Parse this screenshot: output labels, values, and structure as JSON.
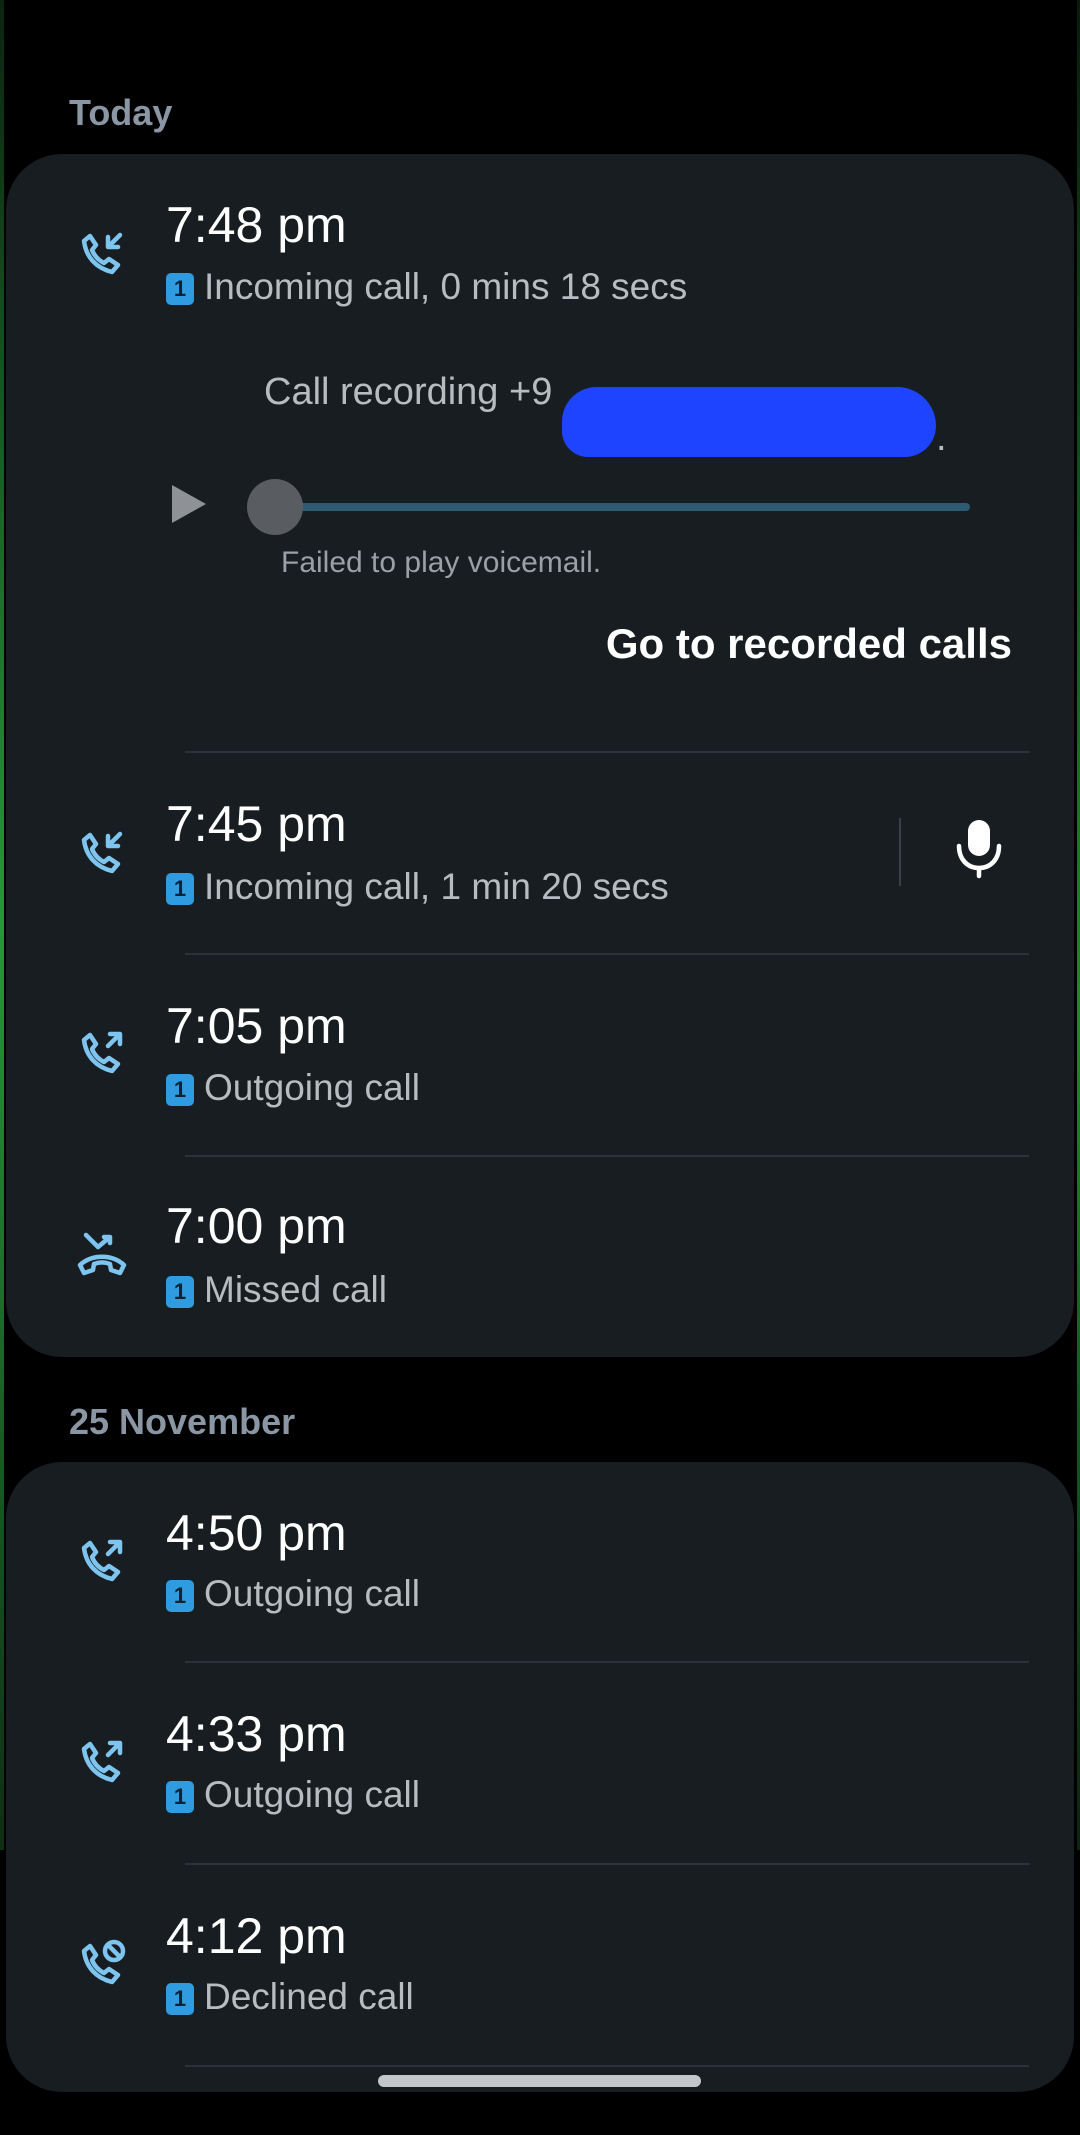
{
  "sections": [
    {
      "label": "Today"
    },
    {
      "label": "25 November"
    }
  ],
  "today_calls": [
    {
      "time": "7:48 pm",
      "sim": "1",
      "status": "Incoming call, 0 mins 18 secs",
      "icon": "incoming-call-icon"
    },
    {
      "time": "7:45 pm",
      "sim": "1",
      "status": "Incoming call, 1 min 20 secs",
      "icon": "incoming-call-icon"
    },
    {
      "time": "7:05 pm",
      "sim": "1",
      "status": "Outgoing call",
      "icon": "outgoing-call-icon"
    },
    {
      "time": "7:00 pm",
      "sim": "1",
      "status": "Missed call",
      "icon": "missed-call-icon"
    }
  ],
  "recording": {
    "title": "Call recording +9",
    "trailing": ".",
    "error": "Failed to play voicemail.",
    "goto_label": "Go to recorded calls",
    "progress": 0
  },
  "nov_calls": [
    {
      "time": "4:50 pm",
      "sim": "1",
      "status": "Outgoing call",
      "icon": "outgoing-call-icon"
    },
    {
      "time": "4:33 pm",
      "sim": "1",
      "status": "Outgoing call",
      "icon": "outgoing-call-icon"
    },
    {
      "time": "4:12 pm",
      "sim": "1",
      "status": "Declined call",
      "icon": "declined-call-icon"
    }
  ],
  "colors": {
    "background": "#000000",
    "card": "#181d21",
    "icon_blue": "#7dc4ef",
    "sim_badge": "#2f9be0",
    "redaction": "#1e44ff"
  }
}
